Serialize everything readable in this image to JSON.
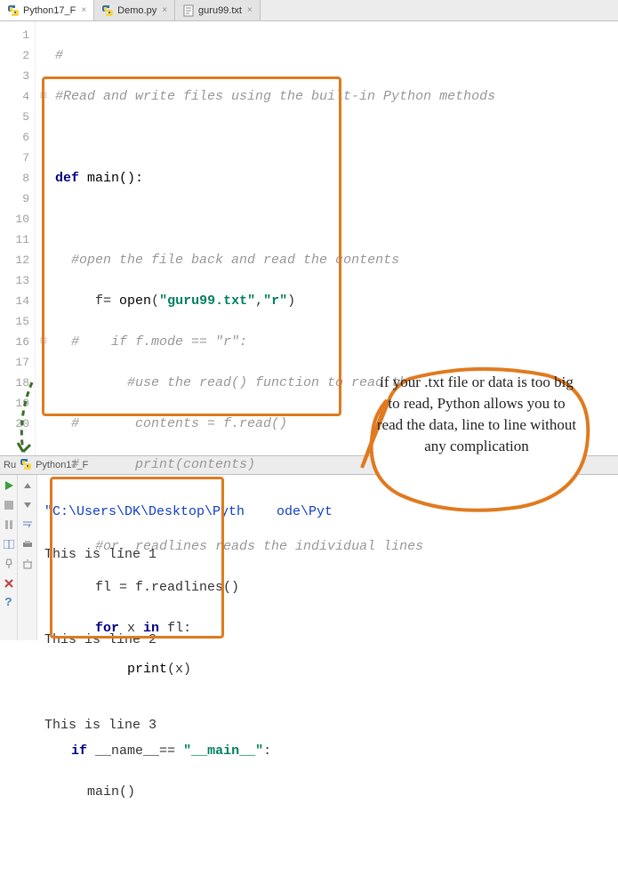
{
  "tabs": [
    {
      "label": "Python17_F",
      "icon": "python"
    },
    {
      "label": "Demo.py",
      "icon": "python"
    },
    {
      "label": "guru99.txt",
      "icon": "text"
    }
  ],
  "lines": [
    "1",
    "2",
    "3",
    "4",
    "5",
    "6",
    "7",
    "8",
    "9",
    "10",
    "11",
    "12",
    "13",
    "14",
    "15",
    "16",
    "17",
    "18",
    "19",
    "20"
  ],
  "folds": [
    "",
    "",
    "",
    "⊟",
    "",
    "",
    "",
    "",
    "",
    "",
    "",
    "",
    "",
    "",
    "",
    "⊟",
    "",
    "",
    "",
    ""
  ],
  "code": {
    "l1_cm": "#",
    "l2_cm": "#Read and write files using the built-in Python methods",
    "l4_def": "def",
    "l4_name": " main():",
    "l6_cm": "#open the file back and read the contents",
    "l7_a": "f= ",
    "l7_open": "open",
    "l7_p1": "(",
    "l7_s1": "\"guru99.txt\"",
    "l7_c": ",",
    "l7_s2": "\"r\"",
    "l7_p2": ")",
    "l8_cm": "#    if f.mode == \"r\":",
    "l9_cm": "#use the read() function to read the content",
    "l10_cm": "#       contents = f.read()",
    "l11_cm": "#       print(contents)",
    "l13_cm": "#or, readlines reads the individual lines",
    "l14": "fl = f.readlines()",
    "l15_for": "for",
    "l15_mid": " x ",
    "l15_in": "in",
    "l15_end": " fl:",
    "l16_a": "print",
    "l16_b": "(x)",
    "l18_if": "if",
    "l18_mid": " __name__== ",
    "l18_str": "\"__main__\"",
    "l18_end": ":",
    "l19": "main()"
  },
  "run": {
    "label": "Ru",
    "target": "Python17_F"
  },
  "console": {
    "path": "\"C:\\Users\\DK\\Desktop\\Pyth    ode\\Pyt",
    "out1": "This is line 1",
    "out2": "This is line 2",
    "out3": "This is line 3"
  },
  "callout": "if your .txt file or data is too big to read, Python allows you to read the data, line to line without any complication"
}
